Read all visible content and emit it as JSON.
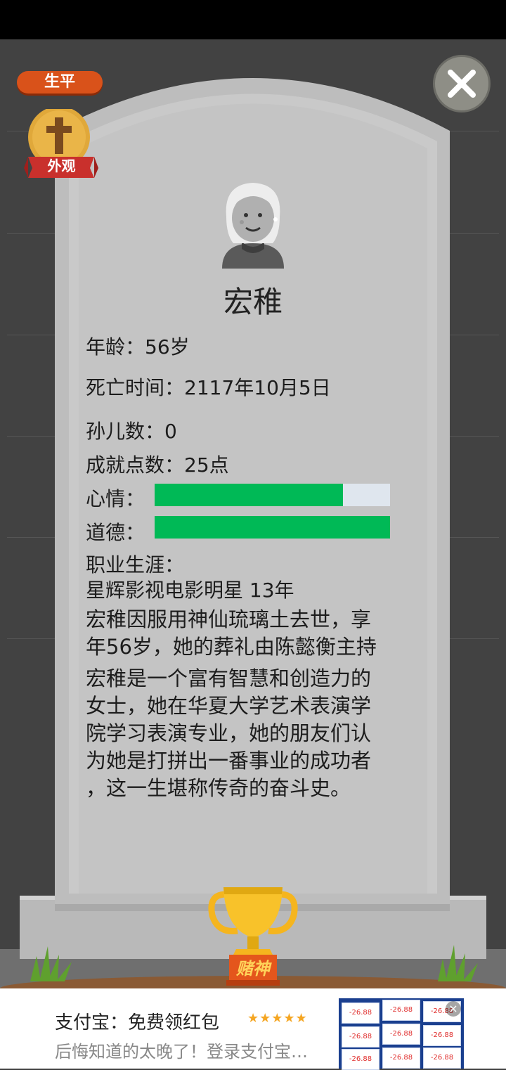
{
  "header": {
    "tab_label": "生平",
    "appearance_label": "外观"
  },
  "person": {
    "name": "宏稚",
    "age": "年龄：56岁",
    "death_time": "死亡时间：2117年10月5日",
    "grandchildren": "孙儿数：0",
    "achievement_points": "成就点数：25点"
  },
  "stats": {
    "mood_label": "心情：",
    "mood_value": 0.8,
    "morality_label": "道德：",
    "morality_value": 1.0,
    "bar_color": "#00b956"
  },
  "career": {
    "label": "职业生涯：",
    "entry": "星辉影视电影明星 13年"
  },
  "bio": {
    "death_text_1": "宏稚因服用神仙琉璃土去世，享",
    "death_text_2": "年56岁，她的葬礼由陈懿衡主持",
    "desc_1": "宏稚是一个富有智慧和创造力的",
    "desc_2": "女士，她在华夏大学艺术表演学",
    "desc_3": "院学习表演专业，她的朋友们认",
    "desc_4": "为她是打拼出一番事业的成功者",
    "desc_5": "，这一生堪称传奇的奋斗史。"
  },
  "trophy": {
    "label": "赌神"
  },
  "ad": {
    "title": "支付宝：免费领红包",
    "stars": "★★★★★",
    "description": "后悔知道的太晚了！登录支付宝…",
    "thumb_price": "-26.88"
  },
  "icons": {
    "close": "close-icon",
    "cross": "cross-icon",
    "trophy": "trophy-icon"
  }
}
